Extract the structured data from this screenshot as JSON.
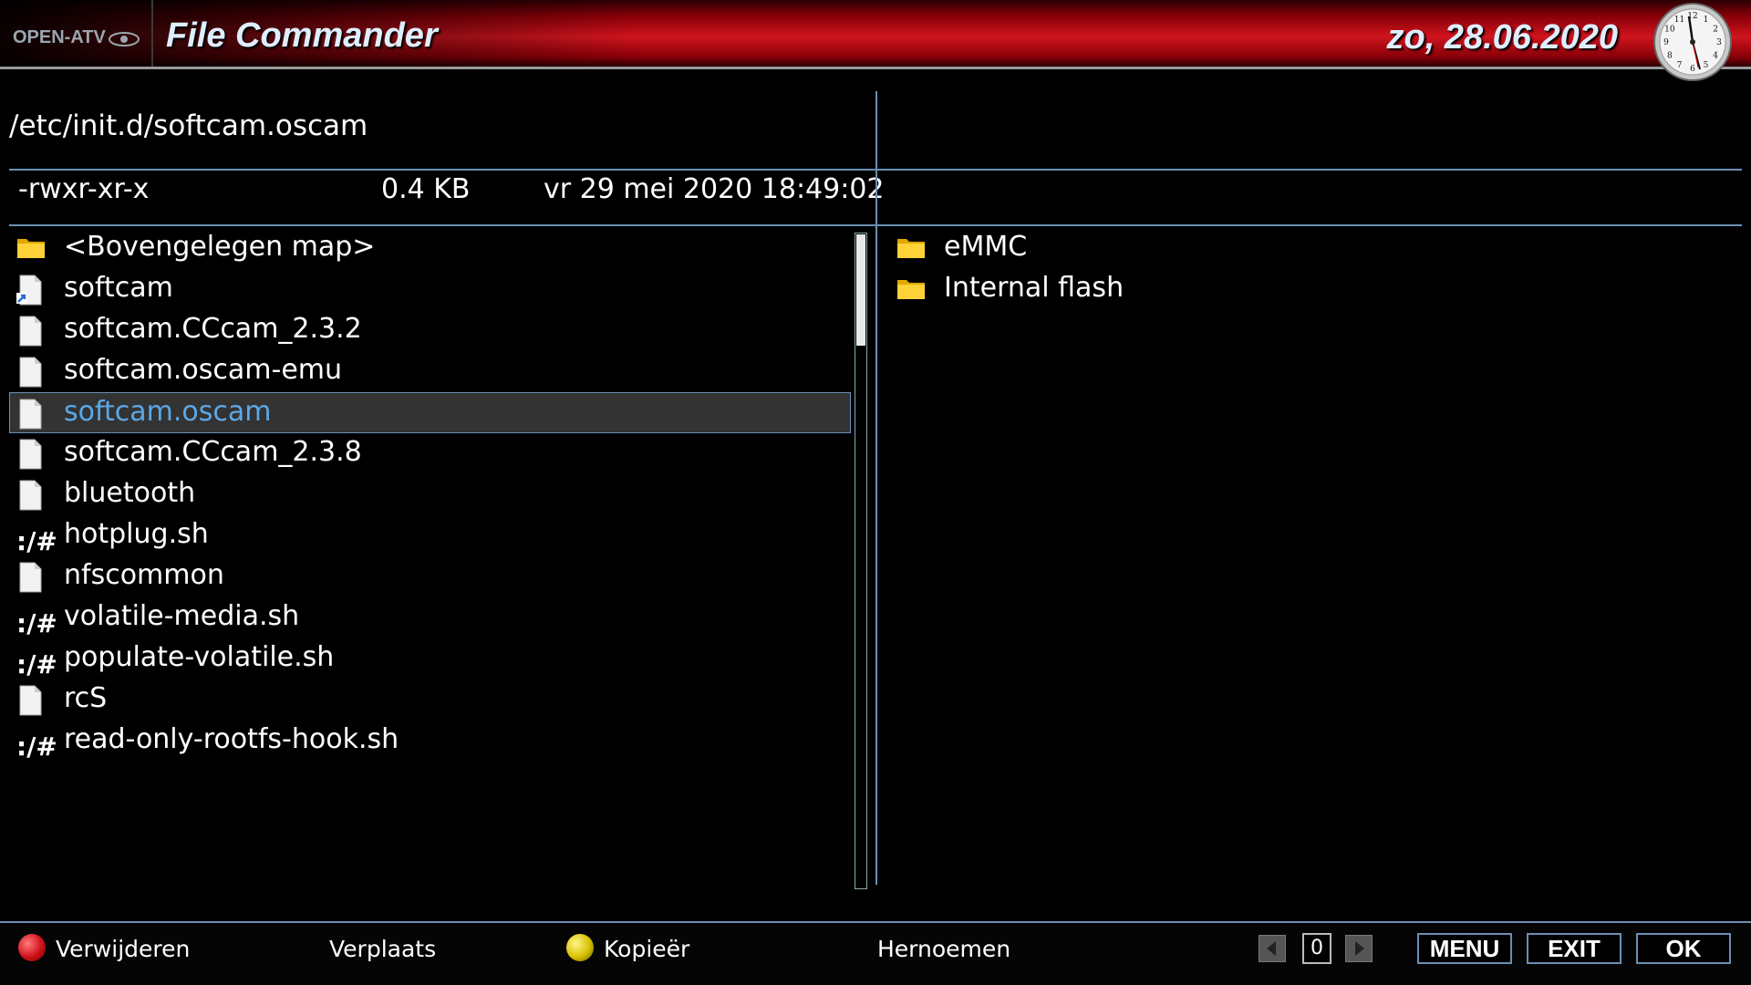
{
  "header": {
    "logo": "OPEN-ATV",
    "title": "File Commander",
    "date": "zo, 28.06.2020"
  },
  "clock": {
    "hour_label": "12",
    "numbers": [
      "12",
      "1",
      "2",
      "3",
      "4",
      "5",
      "6",
      "7",
      "8",
      "9",
      "10",
      "11"
    ]
  },
  "left_panel": {
    "path": "/etc/init.d/softcam.oscam",
    "permissions": "-rwxr-xr-x",
    "size": "0.4 KB",
    "modified": "vr 29 mei 2020 18:49:02",
    "items": [
      {
        "label": "<Bovengelegen map>",
        "icon": "folder"
      },
      {
        "label": "softcam",
        "icon": "symlink"
      },
      {
        "label": "softcam.CCcam_2.3.2",
        "icon": "file"
      },
      {
        "label": "softcam.oscam-emu",
        "icon": "file"
      },
      {
        "label": "softcam.oscam",
        "icon": "file",
        "selected": true
      },
      {
        "label": "softcam.CCcam_2.3.8",
        "icon": "file"
      },
      {
        "label": "bluetooth",
        "icon": "file"
      },
      {
        "label": "hotplug.sh",
        "icon": "script"
      },
      {
        "label": "nfscommon",
        "icon": "file"
      },
      {
        "label": "volatile-media.sh",
        "icon": "script"
      },
      {
        "label": "populate-volatile.sh",
        "icon": "script"
      },
      {
        "label": "rcS",
        "icon": "file"
      },
      {
        "label": "read-only-rootfs-hook.sh",
        "icon": "script"
      }
    ],
    "script_glyph": ":/#"
  },
  "right_panel": {
    "items": [
      {
        "label": "eMMC",
        "icon": "folder"
      },
      {
        "label": "Internal flash",
        "icon": "folder"
      }
    ]
  },
  "footer": {
    "red": "Verwijderen",
    "green": "Verplaats",
    "yellow": "Kopieër",
    "blue": "Hernoemen",
    "page": "0",
    "menu": "MENU",
    "exit": "EXIT",
    "ok": "OK"
  },
  "colors": {
    "red": "#e8202a",
    "green": "#2fc22f",
    "yellow": "#e0cc10",
    "blue": "#2a7fe0",
    "selected_text": "#5aa8e8",
    "divider": "#6b8fb3"
  }
}
